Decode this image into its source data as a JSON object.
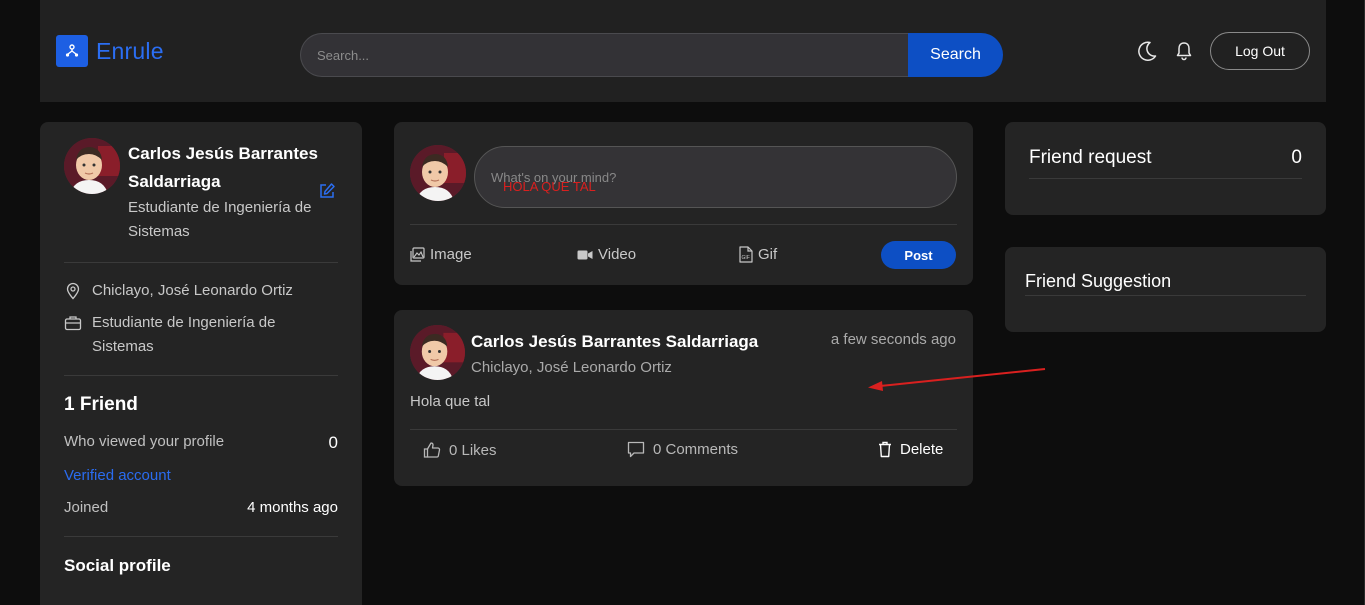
{
  "header": {
    "app_name": "Enrule",
    "search_placeholder": "Search...",
    "search_button": "Search",
    "logout_label": "Log Out"
  },
  "profile": {
    "name": "Carlos Jesús Barrantes Saldarriaga",
    "role": "Estudiante de Ingeniería de Sistemas",
    "location": "Chiclayo, José Leonardo Ortiz",
    "occupation": "Estudiante de Ingeniería de Sistemas",
    "friends_title": "1 Friend",
    "viewed_label": "Who viewed your profile",
    "viewed_count": "0",
    "verified_label": "Verified account",
    "joined_label": "Joined",
    "joined_value": "4 months ago",
    "social_title": "Social profile"
  },
  "composer": {
    "placeholder": "What's on your mind?",
    "typed_value": "HOLA QUE TAL",
    "actions": {
      "image": "Image",
      "video": "Video",
      "gif": "Gif"
    },
    "post_button": "Post"
  },
  "post": {
    "author": "Carlos Jesús Barrantes Saldarriaga",
    "location": "Chiclayo, José Leonardo Ortiz",
    "time": "a few seconds ago",
    "text": "Hola que tal",
    "likes": "0 Likes",
    "comments": "0 Comments",
    "delete": "Delete"
  },
  "sidebar_right": {
    "friend_request_title": "Friend request",
    "friend_request_count": "0",
    "friend_suggestion_title": "Friend Suggestion"
  },
  "colors": {
    "accent": "#0d4fc4",
    "brand": "#2b6ef2",
    "annotation": "#d9201f"
  }
}
